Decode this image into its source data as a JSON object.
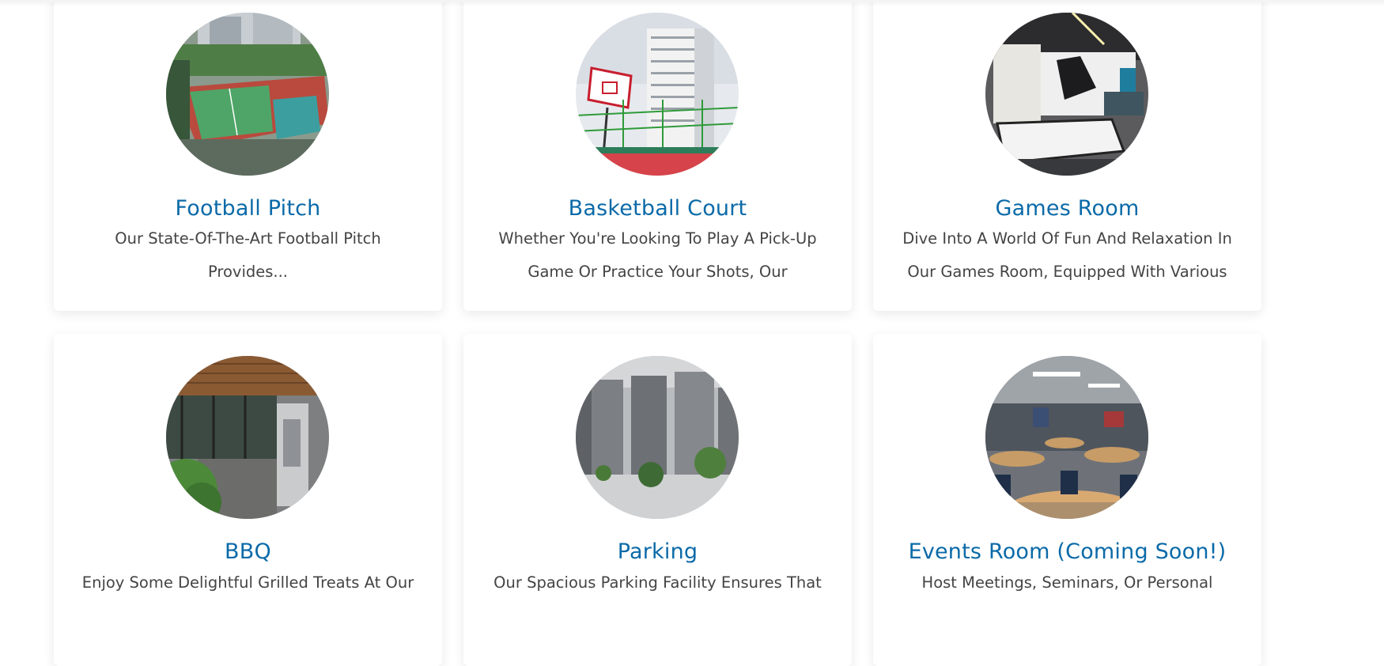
{
  "amenities": [
    {
      "title": "Football Pitch",
      "description": "Our State-Of-The-Art Football Pitch Provides..."
    },
    {
      "title": "Basketball Court",
      "description": "Whether You're Looking To Play A Pick-Up Game Or Practice Your Shots, Our"
    },
    {
      "title": "Games Room",
      "description": "Dive Into A World Of Fun And Relaxation In Our Games Room, Equipped With Various"
    },
    {
      "title": "BBQ",
      "description": "Enjoy Some Delightful Grilled Treats At Our"
    },
    {
      "title": "Parking",
      "description": "Our Spacious Parking Facility Ensures That"
    },
    {
      "title": "Events Room (Coming Soon!)",
      "description": "Host Meetings, Seminars, Or Personal"
    }
  ],
  "colors": {
    "title": "#0b6aa8",
    "text": "#444444",
    "card_bg": "#ffffff"
  }
}
